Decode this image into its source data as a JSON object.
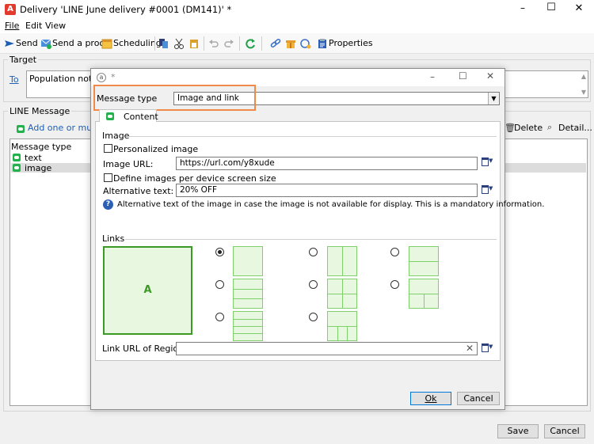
{
  "window": {
    "title": "Delivery 'LINE June delivery #0001 (DM141)' *",
    "controls": [
      "–",
      "☐",
      "✕"
    ]
  },
  "menu": [
    "File",
    "Edit",
    "View"
  ],
  "toolbar": {
    "send": "Send",
    "send_proof": "Send a proof",
    "scheduling": "Scheduling",
    "properties": "Properties"
  },
  "target": {
    "legend": "Target",
    "to_link": "To",
    "population": "Population not defined"
  },
  "line_message": {
    "legend": "LINE Message",
    "add_link": "Add one or multiple messages",
    "delete": "Delete",
    "detail": "Detail...",
    "list_header": "Message type",
    "items": [
      {
        "label": "text"
      },
      {
        "label": "image"
      }
    ]
  },
  "footer": {
    "save": "Save",
    "cancel": "Cancel"
  },
  "dialog": {
    "title": "*",
    "message_type_label": "Message type",
    "message_type_value": "Image and link",
    "tab_content": "Content",
    "image_section": "Image",
    "personalized_image": "Personalized image",
    "image_url_label": "Image URL:",
    "image_url_value": "https://url.com/y8xude",
    "define_images": "Define images per device screen size",
    "alt_text_label": "Alternative text:",
    "alt_text_value": "20% OFF",
    "info_text": "Alternative text of the image in case the image is not available for display. This is a mandatory information.",
    "links_section": "Links",
    "region_a": "A",
    "link_url_label": "Link URL of Region A:",
    "link_url_value": "",
    "ok": "Ok",
    "cancel": "Cancel"
  },
  "colors": {
    "highlight_box": "#f08a4b",
    "layout_fill": "#e8f7e0",
    "layout_border": "#7fd06a",
    "region_a_border": "#3a9a24",
    "accent": "#0078d7",
    "app_icon": "#e23b2e"
  }
}
